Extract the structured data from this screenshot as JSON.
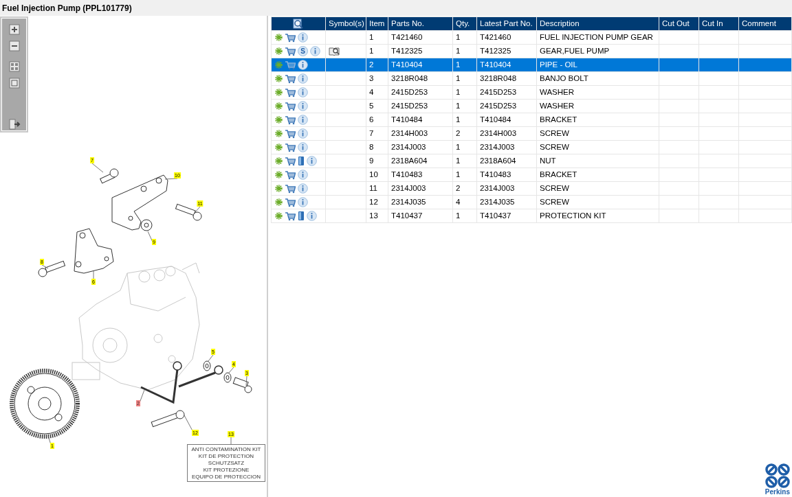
{
  "window": {
    "title": "Fuel Injection Pump (PPL101779)"
  },
  "diagram": {
    "callouts": [
      {
        "label": "7",
        "selected": false
      },
      {
        "label": "10",
        "selected": false
      },
      {
        "label": "11",
        "selected": false
      },
      {
        "label": "9",
        "selected": false
      },
      {
        "label": "8",
        "selected": false
      },
      {
        "label": "6",
        "selected": false
      },
      {
        "label": "5",
        "selected": false
      },
      {
        "label": "4",
        "selected": false
      },
      {
        "label": "3",
        "selected": false
      },
      {
        "label": "2",
        "selected": true
      },
      {
        "label": "12",
        "selected": false
      },
      {
        "label": "13",
        "selected": false
      },
      {
        "label": "1",
        "selected": false
      }
    ],
    "kit_label": [
      "ANTI CONTAMINATION KIT",
      "KIT DE PROTECTION",
      "SCHUTZSATZ",
      "KIT PROTEZIONE",
      "EQUIPO DE PROTECCION"
    ]
  },
  "table": {
    "columns": [
      "Symbol(s)",
      "Item",
      "Parts No.",
      "Qty.",
      "Latest Part No.",
      "Description",
      "Cut Out",
      "Cut In",
      "Comment"
    ],
    "rows": [
      {
        "selected": false,
        "symbol": false,
        "manual": false,
        "item": "1",
        "parts_no": "T421460",
        "qty": "1",
        "latest": "T421460",
        "description": "FUEL INJECTION PUMP GEAR"
      },
      {
        "selected": false,
        "symbol": true,
        "manual": false,
        "badge": "S",
        "item": "1",
        "parts_no": "T412325",
        "qty": "1",
        "latest": "T412325",
        "description": "GEAR,FUEL PUMP"
      },
      {
        "selected": true,
        "symbol": false,
        "manual": false,
        "item": "2",
        "parts_no": "T410404",
        "qty": "1",
        "latest": "T410404",
        "description": "PIPE - OIL"
      },
      {
        "selected": false,
        "symbol": false,
        "manual": false,
        "item": "3",
        "parts_no": "3218R048",
        "qty": "1",
        "latest": "3218R048",
        "description": "BANJO BOLT"
      },
      {
        "selected": false,
        "symbol": false,
        "manual": false,
        "item": "4",
        "parts_no": "2415D253",
        "qty": "1",
        "latest": "2415D253",
        "description": "WASHER"
      },
      {
        "selected": false,
        "symbol": false,
        "manual": false,
        "item": "5",
        "parts_no": "2415D253",
        "qty": "1",
        "latest": "2415D253",
        "description": "WASHER"
      },
      {
        "selected": false,
        "symbol": false,
        "manual": false,
        "item": "6",
        "parts_no": "T410484",
        "qty": "1",
        "latest": "T410484",
        "description": "BRACKET"
      },
      {
        "selected": false,
        "symbol": false,
        "manual": false,
        "item": "7",
        "parts_no": "2314H003",
        "qty": "2",
        "latest": "2314H003",
        "description": "SCREW"
      },
      {
        "selected": false,
        "symbol": false,
        "manual": false,
        "item": "8",
        "parts_no": "2314J003",
        "qty": "1",
        "latest": "2314J003",
        "description": "SCREW"
      },
      {
        "selected": false,
        "symbol": false,
        "manual": true,
        "item": "9",
        "parts_no": "2318A604",
        "qty": "1",
        "latest": "2318A604",
        "description": "NUT"
      },
      {
        "selected": false,
        "symbol": false,
        "manual": false,
        "item": "10",
        "parts_no": "T410483",
        "qty": "1",
        "latest": "T410483",
        "description": "BRACKET"
      },
      {
        "selected": false,
        "symbol": false,
        "manual": false,
        "item": "11",
        "parts_no": "2314J003",
        "qty": "2",
        "latest": "2314J003",
        "description": "SCREW"
      },
      {
        "selected": false,
        "symbol": false,
        "manual": false,
        "item": "12",
        "parts_no": "2314J035",
        "qty": "4",
        "latest": "2314J035",
        "description": "SCREW"
      },
      {
        "selected": false,
        "symbol": false,
        "manual": true,
        "item": "13",
        "parts_no": "T410437",
        "qty": "1",
        "latest": "T410437",
        "description": "PROTECTION KIT"
      }
    ]
  },
  "logo": {
    "text": "Perkins"
  }
}
